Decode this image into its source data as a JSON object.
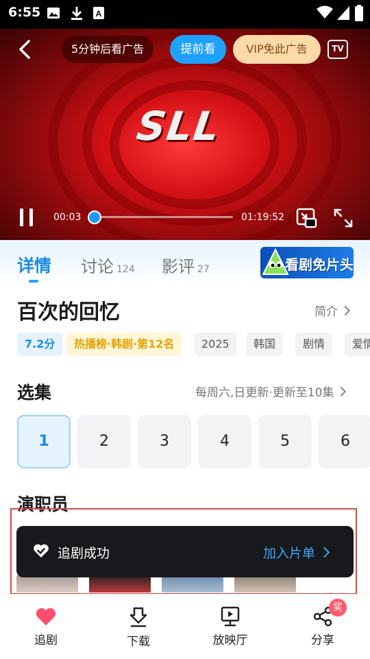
{
  "status_bar": {
    "time": "6:55"
  },
  "player": {
    "ad_notice": "5分钟后看广告",
    "watch_now_label": "提前看",
    "vip_label": "VIP免此广告",
    "tv_label": "TV",
    "logo_text": "SLL",
    "current_time": "00:03",
    "total_time": "01:19:52",
    "progress_fraction": 0.0
  },
  "tabs": [
    {
      "label": "详情",
      "count": ""
    },
    {
      "label": "讨论",
      "count": "124"
    },
    {
      "label": "影评",
      "count": "27"
    }
  ],
  "promo": {
    "text": "看剧免片头"
  },
  "show": {
    "title": "百次的回忆",
    "intro_label": "简介",
    "tags": [
      "7.2分",
      "热播榜·韩剧·第12名",
      "2025",
      "韩国",
      "剧情",
      "爱情"
    ]
  },
  "episodes": {
    "section_title": "选集",
    "update_info": "每周六,日更新·更新至10集",
    "items": [
      "1",
      "2",
      "3",
      "4",
      "5",
      "6"
    ],
    "selected": "1"
  },
  "cast": {
    "section_title": "演职员"
  },
  "toast": {
    "message": "追剧成功",
    "action": "加入片单"
  },
  "bottom_nav": [
    {
      "label": "追剧"
    },
    {
      "label": "下载"
    },
    {
      "label": "放映厅"
    },
    {
      "label": "分享",
      "badge": "奖"
    }
  ],
  "colors": {
    "accent": "#1ea1ff",
    "heart": "#ff4d6d",
    "vip": "#fcd9a8"
  }
}
